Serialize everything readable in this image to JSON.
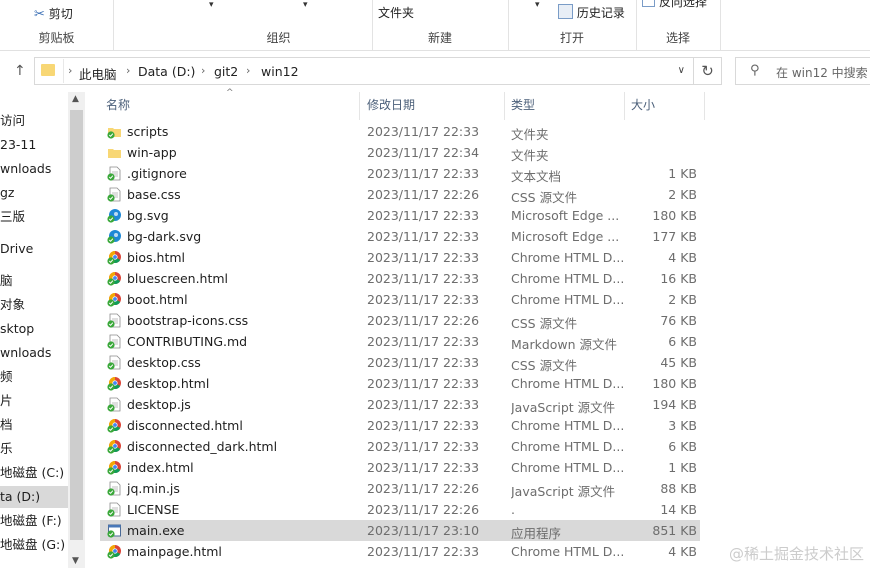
{
  "ribbon": {
    "cut_label": "剪切",
    "clipboard_label": "剪贴板",
    "organize_label": "组织",
    "new_folder_label": "文件夹",
    "new_label": "新建",
    "history_label": "历史记录",
    "open_label": "打开",
    "invert_label": "反向选择",
    "select_label": "选择"
  },
  "address": {
    "crumbs": [
      "此电脑",
      "Data (D:)",
      "git2",
      "win12"
    ]
  },
  "search": {
    "placeholder": "在 win12 中搜索"
  },
  "nav": {
    "items": [
      "访问",
      "23-11",
      "wnloads",
      "gz",
      "三版",
      "Drive",
      "脑",
      "对象",
      "sktop",
      "wnloads",
      "频",
      "片",
      "档",
      "乐",
      "地磁盘 (C:)",
      "ta (D:)",
      "地磁盘 (F:)",
      "地磁盘 (G:)"
    ]
  },
  "columns": {
    "name": "名称",
    "date": "修改日期",
    "type": "类型",
    "size": "大小"
  },
  "files": [
    {
      "name": "scripts",
      "date": "2023/11/17 22:33",
      "type": "文件夹",
      "size": "",
      "icon": "folder-sync"
    },
    {
      "name": "win-app",
      "date": "2023/11/17 22:34",
      "type": "文件夹",
      "size": "",
      "icon": "folder"
    },
    {
      "name": ".gitignore",
      "date": "2023/11/17 22:33",
      "type": "文本文档",
      "size": "1 KB",
      "icon": "doc"
    },
    {
      "name": "base.css",
      "date": "2023/11/17 22:26",
      "type": "CSS 源文件",
      "size": "2 KB",
      "icon": "doc"
    },
    {
      "name": "bg.svg",
      "date": "2023/11/17 22:33",
      "type": "Microsoft Edge ...",
      "size": "180 KB",
      "icon": "edge"
    },
    {
      "name": "bg-dark.svg",
      "date": "2023/11/17 22:33",
      "type": "Microsoft Edge ...",
      "size": "177 KB",
      "icon": "edge"
    },
    {
      "name": "bios.html",
      "date": "2023/11/17 22:33",
      "type": "Chrome HTML D...",
      "size": "4 KB",
      "icon": "chrome"
    },
    {
      "name": "bluescreen.html",
      "date": "2023/11/17 22:33",
      "type": "Chrome HTML D...",
      "size": "16 KB",
      "icon": "chrome"
    },
    {
      "name": "boot.html",
      "date": "2023/11/17 22:33",
      "type": "Chrome HTML D...",
      "size": "2 KB",
      "icon": "chrome"
    },
    {
      "name": "bootstrap-icons.css",
      "date": "2023/11/17 22:26",
      "type": "CSS 源文件",
      "size": "76 KB",
      "icon": "doc"
    },
    {
      "name": "CONTRIBUTING.md",
      "date": "2023/11/17 22:33",
      "type": "Markdown 源文件",
      "size": "6 KB",
      "icon": "doc"
    },
    {
      "name": "desktop.css",
      "date": "2023/11/17 22:33",
      "type": "CSS 源文件",
      "size": "45 KB",
      "icon": "doc"
    },
    {
      "name": "desktop.html",
      "date": "2023/11/17 22:33",
      "type": "Chrome HTML D...",
      "size": "180 KB",
      "icon": "chrome"
    },
    {
      "name": "desktop.js",
      "date": "2023/11/17 22:33",
      "type": "JavaScript 源文件",
      "size": "194 KB",
      "icon": "doc"
    },
    {
      "name": "disconnected.html",
      "date": "2023/11/17 22:33",
      "type": "Chrome HTML D...",
      "size": "3 KB",
      "icon": "chrome"
    },
    {
      "name": "disconnected_dark.html",
      "date": "2023/11/17 22:33",
      "type": "Chrome HTML D...",
      "size": "6 KB",
      "icon": "chrome"
    },
    {
      "name": "index.html",
      "date": "2023/11/17 22:33",
      "type": "Chrome HTML D...",
      "size": "1 KB",
      "icon": "chrome"
    },
    {
      "name": "jq.min.js",
      "date": "2023/11/17 22:26",
      "type": "JavaScript 源文件",
      "size": "88 KB",
      "icon": "doc"
    },
    {
      "name": "LICENSE",
      "date": "2023/11/17 22:26",
      "type": ".",
      "size": "14 KB",
      "icon": "doc"
    },
    {
      "name": "main.exe",
      "date": "2023/11/17 23:10",
      "type": "应用程序",
      "size": "851 KB",
      "icon": "exe",
      "selected": true
    },
    {
      "name": "mainpage.html",
      "date": "2023/11/17 22:33",
      "type": "Chrome HTML D...",
      "size": "4 KB",
      "icon": "chrome"
    }
  ],
  "watermark": "@稀土掘金技术社区",
  "colors": {
    "folder": "#f8d775",
    "selection": "#d9d9d9",
    "sync_green": "#3aa83a"
  }
}
